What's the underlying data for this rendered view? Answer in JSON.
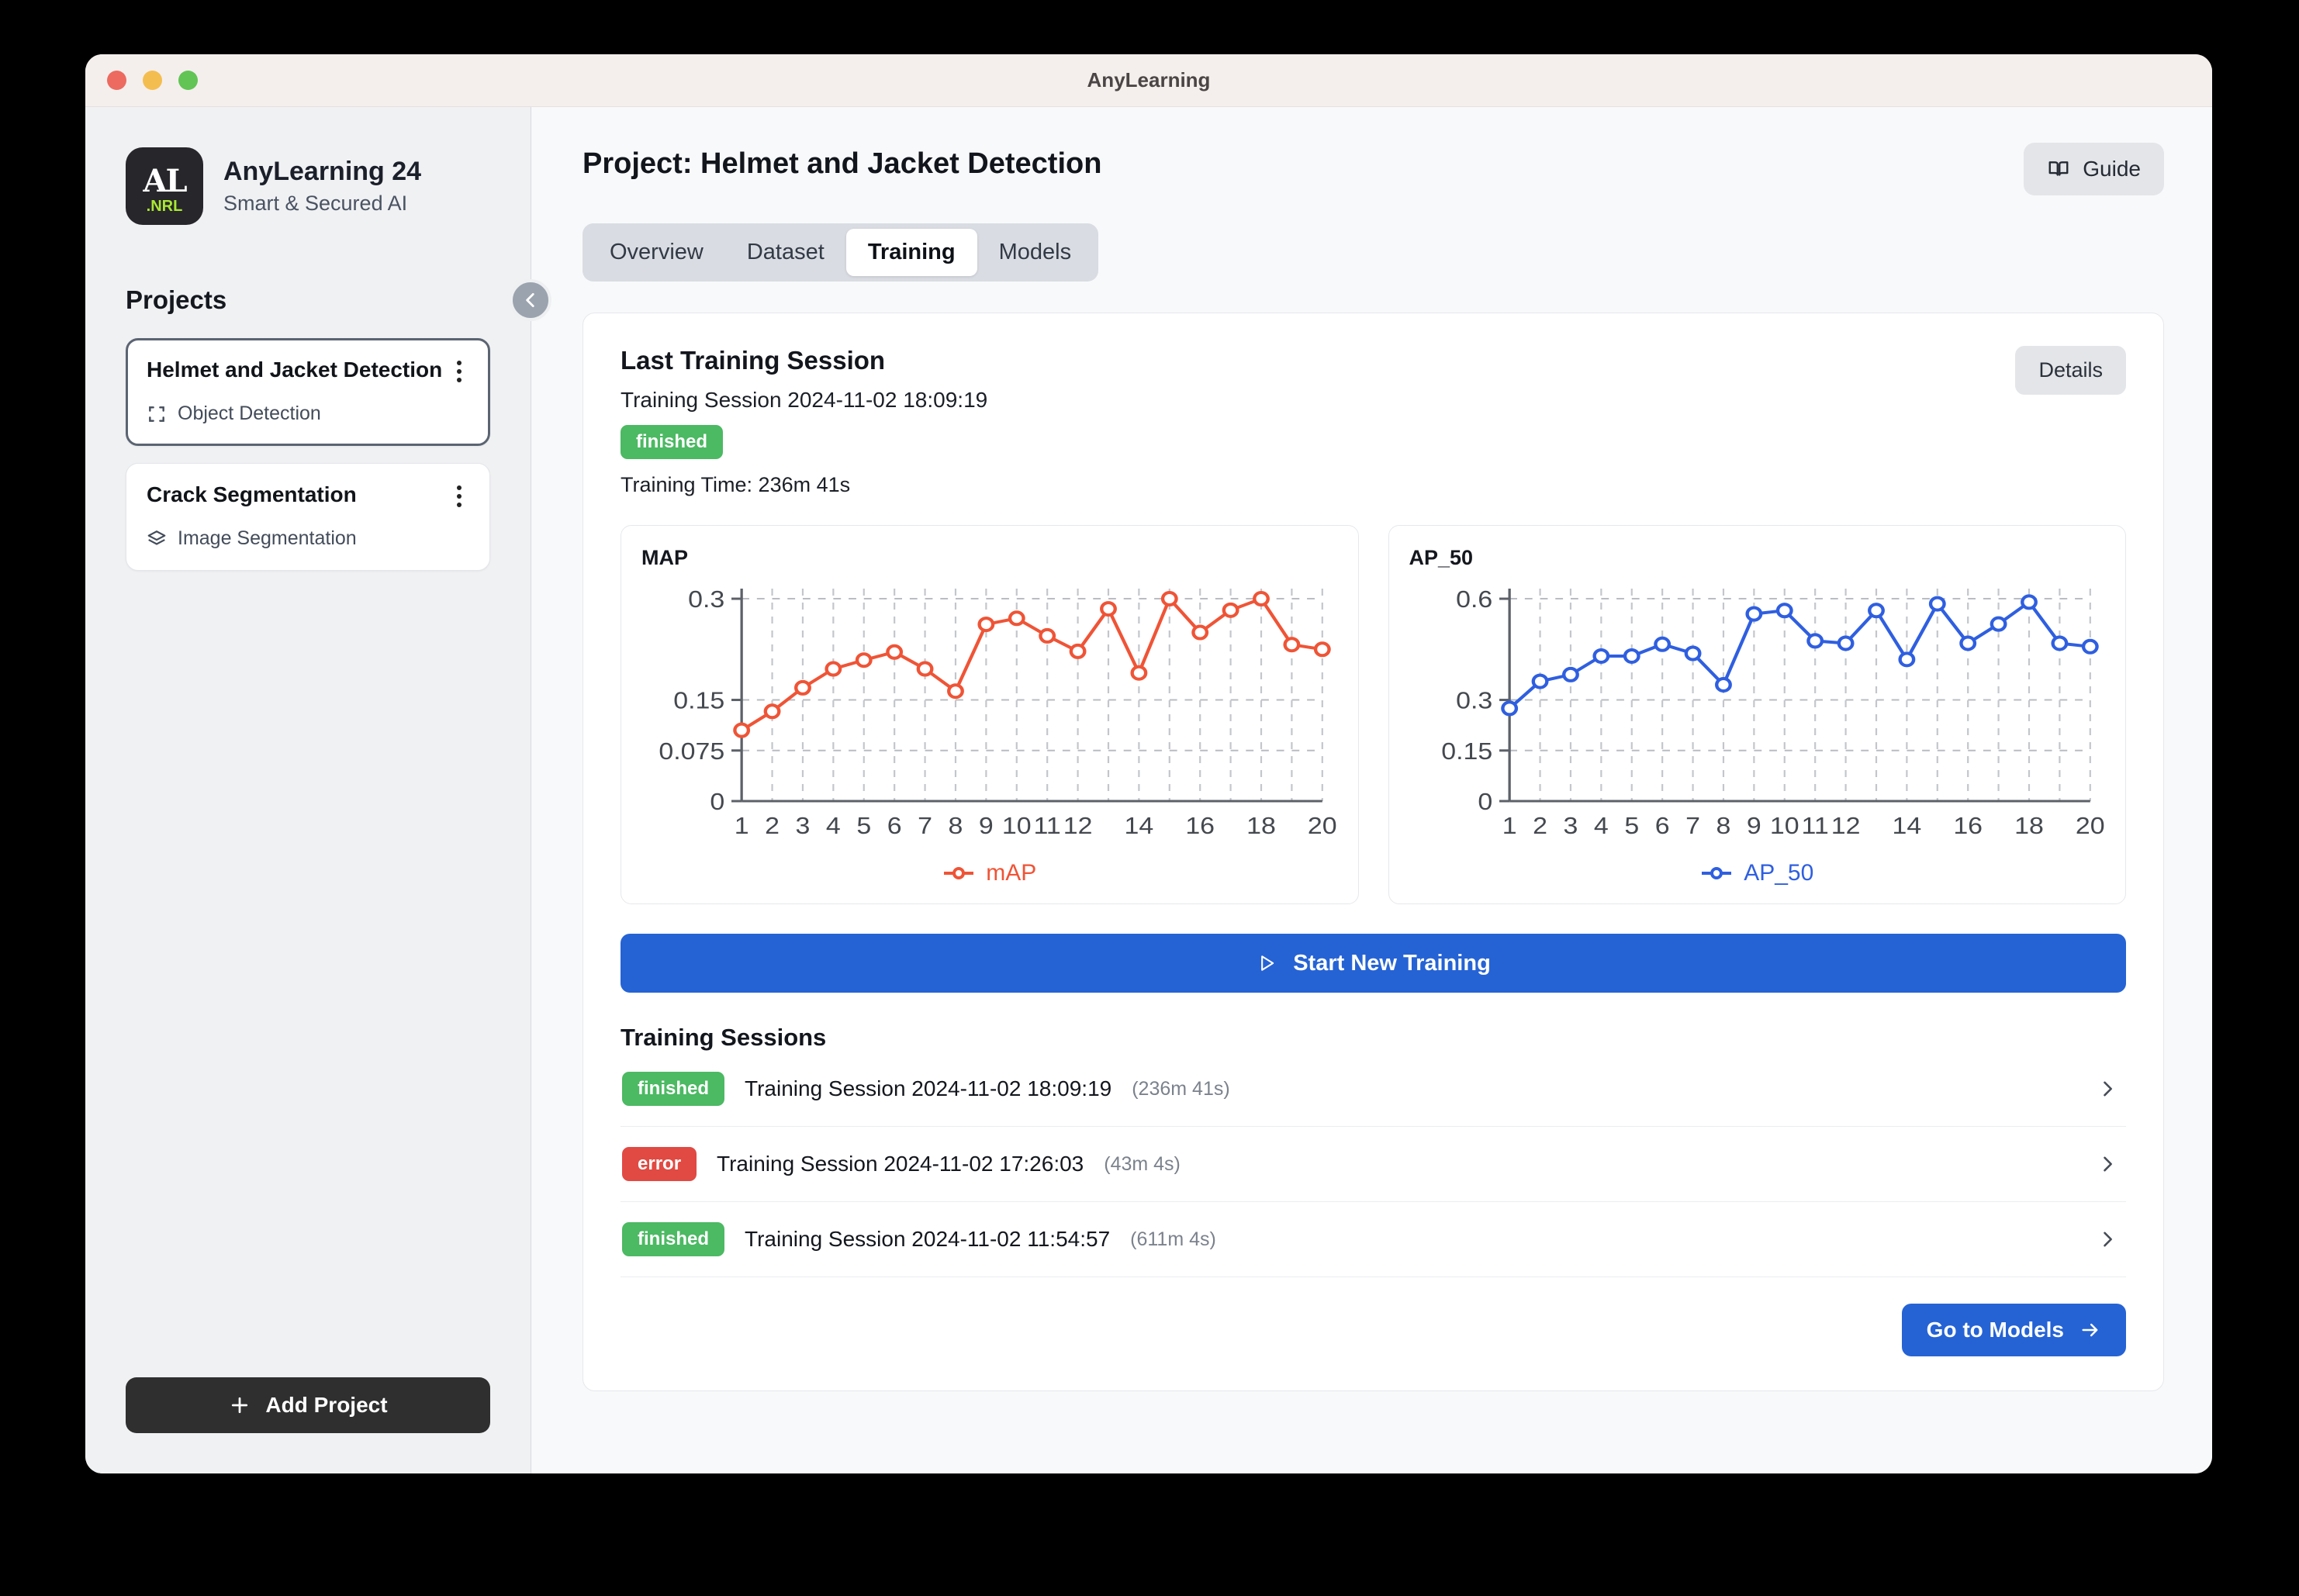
{
  "window": {
    "title": "AnyLearning",
    "traffic_lights": [
      "close",
      "minimize",
      "zoom"
    ]
  },
  "sidebar": {
    "brand": {
      "logo_mark": "AL",
      "logo_sub": ".NRL",
      "title": "AnyLearning 24",
      "subtitle": "Smart & Secured AI"
    },
    "projects_heading": "Projects",
    "projects": [
      {
        "name": "Helmet and Jacket Detection",
        "type": "Object Detection",
        "type_icon": "crop-frame-icon",
        "active": true
      },
      {
        "name": "Crack Segmentation",
        "type": "Image Segmentation",
        "type_icon": "layers-icon",
        "active": false
      }
    ],
    "add_project_label": "Add Project",
    "collapse_icon": "chevron-left-icon"
  },
  "header": {
    "page_title": "Project: Helmet and Jacket Detection",
    "guide_label": "Guide",
    "guide_icon": "book-icon"
  },
  "tabs": [
    {
      "label": "Overview",
      "active": false
    },
    {
      "label": "Dataset",
      "active": false
    },
    {
      "label": "Training",
      "active": true
    },
    {
      "label": "Models",
      "active": false
    }
  ],
  "last_session": {
    "heading": "Last Training Session",
    "name": "Training Session 2024-11-02 18:09:19",
    "status": "finished",
    "training_time": "Training Time: 236m 41s",
    "details_label": "Details"
  },
  "start_training": {
    "label": "Start New Training",
    "icon": "play-icon"
  },
  "sessions": {
    "heading": "Training Sessions",
    "rows": [
      {
        "status": "finished",
        "name": "Training Session 2024-11-02 18:09:19",
        "duration": "(236m 41s)"
      },
      {
        "status": "error",
        "name": "Training Session 2024-11-02 17:26:03",
        "duration": "(43m 4s)"
      },
      {
        "status": "finished",
        "name": "Training Session 2024-11-02 11:54:57",
        "duration": "(611m 4s)"
      }
    ]
  },
  "footer": {
    "models_label": "Go to Models",
    "models_icon": "arrow-right-icon"
  },
  "colors": {
    "map_line": "#ef5436",
    "ap50_line": "#2f5fe0",
    "primary": "#2563d5",
    "finished": "#4cb963",
    "error": "#e04a43"
  },
  "chart_data": [
    {
      "type": "line",
      "title": "MAP",
      "xlabel": "",
      "ylabel": "",
      "legend": [
        "mAP"
      ],
      "legend_position": "bottom",
      "grid": true,
      "color": "#ef5436",
      "x": [
        1,
        2,
        3,
        4,
        5,
        6,
        7,
        8,
        9,
        10,
        11,
        12,
        13,
        14,
        15,
        16,
        17,
        18,
        19,
        20
      ],
      "xticks": [
        "1",
        "2",
        "3",
        "4",
        "5",
        "6",
        "7",
        "8",
        "9",
        "10",
        "11",
        "12",
        "",
        "14",
        "",
        "16",
        "",
        "18",
        "",
        "20"
      ],
      "yticks": [
        0,
        0.075,
        0.15,
        0.3
      ],
      "ytick_labels": [
        "0",
        "0.075",
        "0.15",
        "0.3"
      ],
      "ylim": [
        0,
        0.315
      ],
      "series": [
        {
          "name": "mAP",
          "values": [
            0.105,
            0.133,
            0.168,
            0.196,
            0.209,
            0.221,
            0.196,
            0.163,
            0.262,
            0.271,
            0.245,
            0.222,
            0.285,
            0.19,
            0.3,
            0.25,
            0.283,
            0.3,
            0.232,
            0.225
          ]
        }
      ]
    },
    {
      "type": "line",
      "title": "AP_50",
      "xlabel": "",
      "ylabel": "",
      "legend": [
        "AP_50"
      ],
      "legend_position": "bottom",
      "grid": true,
      "color": "#2f5fe0",
      "x": [
        1,
        2,
        3,
        4,
        5,
        6,
        7,
        8,
        9,
        10,
        11,
        12,
        13,
        14,
        15,
        16,
        17,
        18,
        19,
        20
      ],
      "xticks": [
        "1",
        "2",
        "3",
        "4",
        "5",
        "6",
        "7",
        "8",
        "9",
        "10",
        "11",
        "12",
        "",
        "14",
        "",
        "16",
        "",
        "18",
        "",
        "20"
      ],
      "yticks": [
        0,
        0.15,
        0.3,
        0.6
      ],
      "ytick_labels": [
        "0",
        "0.15",
        "0.3",
        "0.6"
      ],
      "ylim": [
        0,
        0.63
      ],
      "series": [
        {
          "name": "AP_50",
          "values": [
            0.275,
            0.355,
            0.375,
            0.43,
            0.43,
            0.465,
            0.438,
            0.345,
            0.555,
            0.565,
            0.475,
            0.468,
            0.565,
            0.42,
            0.585,
            0.468,
            0.525,
            0.59,
            0.468,
            0.458
          ]
        }
      ]
    }
  ]
}
